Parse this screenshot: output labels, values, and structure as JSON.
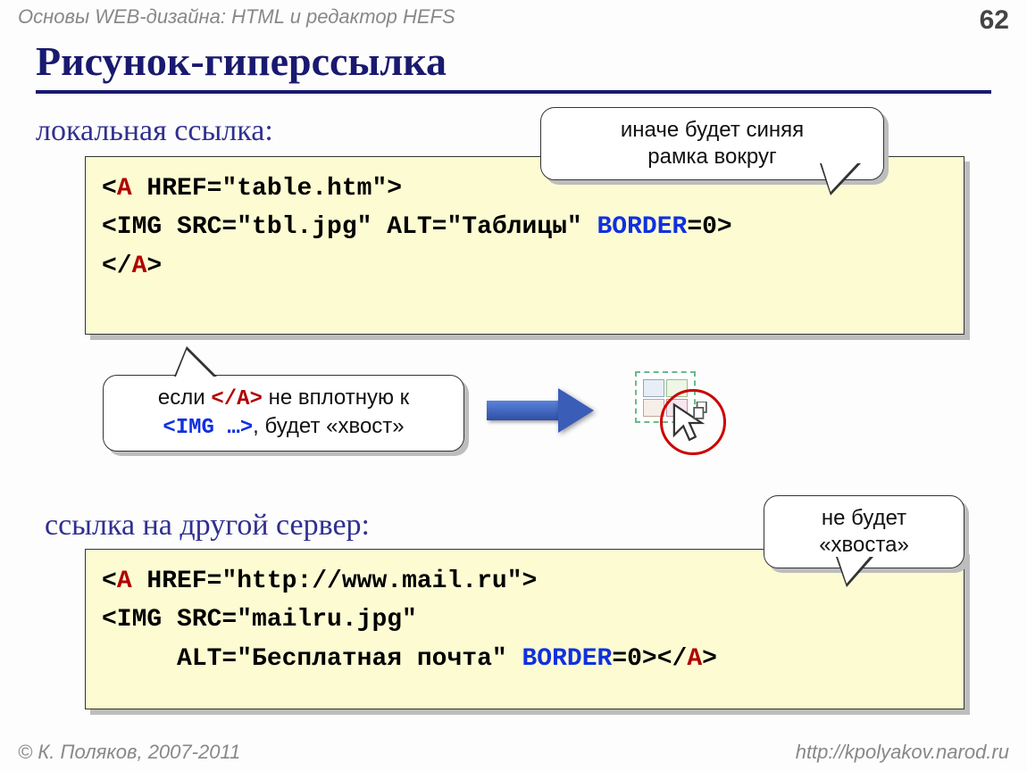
{
  "header": {
    "course": "Основы WEB-дизайна: HTML и редактор HEFS",
    "page": "62"
  },
  "title": "Рисунок-гиперссылка",
  "section1": {
    "heading": "локальная ссылка:",
    "code": {
      "l1": {
        "lt": "<",
        "tag": "A",
        "rest": " HREF=\"table.htm\">"
      },
      "l2": {
        "start": "<IMG SRC=\"tbl.jpg\" ALT=\"Таблицы\" ",
        "border": "BORDER",
        "endnum": "=0>"
      },
      "l3": {
        "lt": "</",
        "tag": "A",
        "gt": ">"
      }
    }
  },
  "calloutTop": {
    "line1": "иначе будет синяя",
    "line2": "рамка вокруг"
  },
  "calloutTail": {
    "p1": "если ",
    "p2": "</A>",
    "p3": " не вплотную к",
    "p4": "<IMG …>",
    "p5": ", будет «хвост»"
  },
  "section2": {
    "heading": "ссылка на другой сервер:",
    "code": {
      "l1": {
        "lt": "<",
        "tag": "A",
        "rest": " HREF=\"http://www.mail.ru\">"
      },
      "l2": "<IMG SRC=\"mailru.jpg\"",
      "l3a": "     ALT=\"Бесплатная почта\" ",
      "l3b": "BORDER",
      "l3c": "=0>",
      "l3_end": {
        "lt": "</",
        "tag": "A",
        "gt": ">"
      }
    }
  },
  "calloutRight": {
    "line1": "не будет",
    "line2": "«хвоста»"
  },
  "footer": {
    "left": "© К. Поляков, 2007-2011",
    "right": "http://kpolyakov.narod.ru"
  }
}
